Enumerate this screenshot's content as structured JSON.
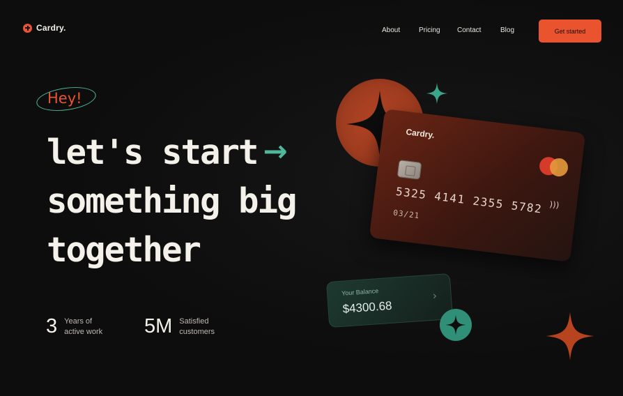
{
  "brand": {
    "name": "Cardry."
  },
  "nav": {
    "items": [
      "About",
      "Pricing",
      "Contact",
      "Blog"
    ],
    "cta": "Get started"
  },
  "hero": {
    "greeting": "Hey!",
    "headline": [
      "let's start",
      "something big",
      "together"
    ]
  },
  "stats": [
    {
      "value": "3",
      "label": "Years of\nactive work"
    },
    {
      "value": "5M",
      "label": "Satisfied\ncustomers"
    }
  ],
  "card": {
    "brand": "Cardry.",
    "number": "5325 4141 2355 5782",
    "expiry": "03/21"
  },
  "balance": {
    "label": "Your Balance",
    "amount": "$4300.68"
  },
  "colors": {
    "accent": "#e9542f",
    "teal": "#4fb89a",
    "background": "#0d0d0d"
  },
  "icons": [
    "plus-circle-icon",
    "arrow-right-icon",
    "chip-icon",
    "mastercard-icon",
    "contactless-icon",
    "chevron-right-icon",
    "sparkle-star-icon"
  ]
}
